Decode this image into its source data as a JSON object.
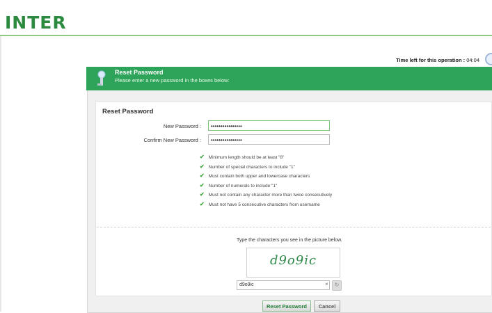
{
  "brand": {
    "logo_text": "INTER"
  },
  "timer": {
    "label": "Time left for this operation :",
    "value": "04:04"
  },
  "header": {
    "title": "Reset Password",
    "subtitle": "Please enter a new password in the boxes below:"
  },
  "form": {
    "section_title": "Reset Password",
    "new_password_label": "New Password :",
    "new_password_value": "••••••••••••••••",
    "confirm_password_label": "Confirm New Password :",
    "confirm_password_value": "••••••••••••••••"
  },
  "rules": [
    "Minimum length should be at least \"8\"",
    "Number of special characters to include \"1\"",
    "Must contain both upper and lowercase characters",
    "Number of numerals to include \"1\"",
    "Must not contain any character more than twice consecutively",
    "Must not have 5 consecutive characters from username"
  ],
  "captcha": {
    "prompt": "Type the characters you see in the picture below.",
    "image_text": "d9o9ic",
    "input_value": "d9o9ic",
    "clear_symbol": "×",
    "refresh_symbol": "↻"
  },
  "buttons": {
    "reset": "Reset Password",
    "cancel": "Cancel"
  },
  "colors": {
    "brand_green": "#2b8a3e",
    "header_green": "#2ea35a",
    "check_green": "#3ba33a"
  },
  "icons": {
    "header": "key-person-icon",
    "timer": "clock-icon",
    "check": "checkmark-icon"
  }
}
